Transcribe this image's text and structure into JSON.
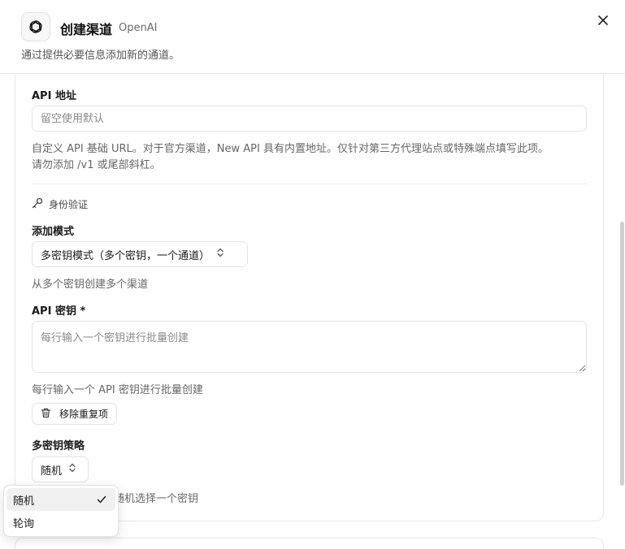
{
  "header": {
    "title": "创建渠道",
    "provider": "OpenAI",
    "subtitle": "通过提供必要信息添加新的通道。",
    "close_icon": "close-icon",
    "logo_icon": "openai-logo-icon"
  },
  "api_address": {
    "label": "API 地址",
    "placeholder": "留空使用默认",
    "help_line1": "自定义 API 基础 URL。对于官方渠道，New API 具有内置地址。仅针对第三方代理站点或特殊端点填写此项。",
    "help_line2": "请勿添加 /v1 或尾部斜杠。"
  },
  "auth": {
    "section_title": "身份验证",
    "section_icon": "key-icon"
  },
  "add_mode": {
    "label": "添加模式",
    "value": "多密钥模式（多个密钥，一个通道）",
    "help": "从多个密钥创建多个渠道"
  },
  "api_key": {
    "label": "API 密钥 *",
    "placeholder": "每行输入一个密钥进行批量创建",
    "help": "每行输入一个 API 密钥进行批量创建",
    "dedupe_button": "移除重复项",
    "dedupe_icon": "trash-icon"
  },
  "strategy": {
    "label": "多密钥策略",
    "value": "随机",
    "help_visible_part": "随机选择一个密钥",
    "options": [
      {
        "label": "随机",
        "selected": true
      },
      {
        "label": "轮询",
        "selected": false
      }
    ]
  },
  "colors": {
    "border": "#e3e3e3",
    "text": "#1a1a1a",
    "muted": "#666666",
    "selected_bg": "#f0f0f0"
  }
}
